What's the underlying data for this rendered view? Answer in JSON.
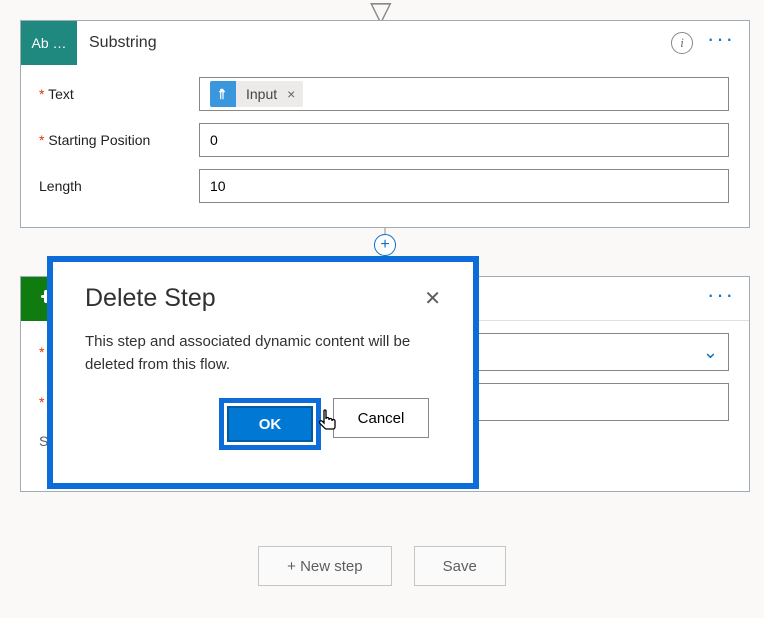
{
  "action1": {
    "icon_label": "Ab …",
    "title": "Substring",
    "fields": {
      "text_label": "Text",
      "text_token": "Input",
      "starting_label": "Starting Position",
      "starting_value": "0",
      "length_label": "Length",
      "length_value": "10"
    }
  },
  "action2": {
    "ellipsis": "···"
  },
  "dialog": {
    "title": "Delete Step",
    "message": "This step and associated dynamic content will be deleted from this flow.",
    "ok": "OK",
    "cancel": "Cancel"
  },
  "footer": {
    "new_step": "+ New step",
    "save": "Save"
  }
}
